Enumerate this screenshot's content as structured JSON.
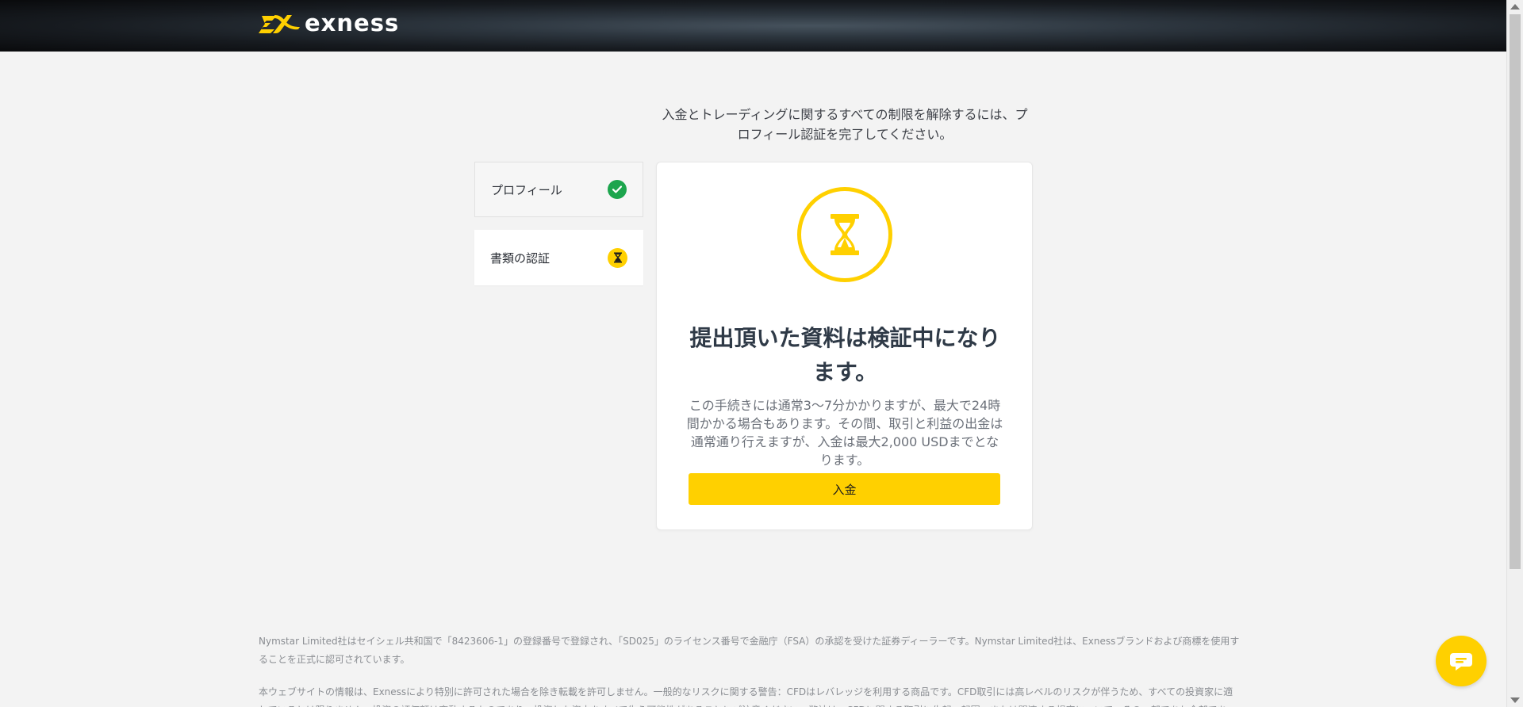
{
  "header": {
    "brand": "exness"
  },
  "intro": {
    "text": "入金とトレーディングに関するすべての制限を解除するには、プロフィール認証を完了してください。"
  },
  "steps": [
    {
      "label": "プロフィール",
      "status": "completed",
      "icon": "check-icon"
    },
    {
      "label": "書類の認証",
      "status": "pending",
      "icon": "hourglass-icon"
    }
  ],
  "status_card": {
    "icon": "hourglass-icon",
    "title": "提出頂いた資料は検証中になります。",
    "description": "この手続きには通常3～7分かかりますが、最大で24時間かかる場合もあります。その間、取引と利益の出金は通常通り行えますが、入金は最大2,000 USDまでとなります。",
    "button_label": "入金"
  },
  "footer": {
    "paragraph_1": "Nymstar Limited社はセイシェル共和国で「8423606-1」の登録番号で登録され、「SD025」のライセンス番号で金融庁（FSA）の承認を受けた証券ディーラーです。Nymstar Limited社は、Exnessブランドおよび商標を使用することを正式に認可されています。",
    "paragraph_2": "本ウェブサイトの情報は、Exnessにより特別に許可された場合を除き転載を許可しません。一般的なリスクに関する警告：CFDはレバレッジを利用する商品です。CFD取引には高レベルのリスクが伴うため、すべての投資家に適しているとは限りません。投資の評価額は変動するものであり、投資した資本をすべて失う可能性があることにご注意ください。弊社は、CFDに関する取引に生起、起因、または関連する損害について、その一部であれ全部であれ、あらゆる"
  },
  "chat": {
    "icon": "chat-icon"
  },
  "colors": {
    "accent": "#ffd000",
    "success": "#1ca54d",
    "header_dark": "#111418"
  }
}
